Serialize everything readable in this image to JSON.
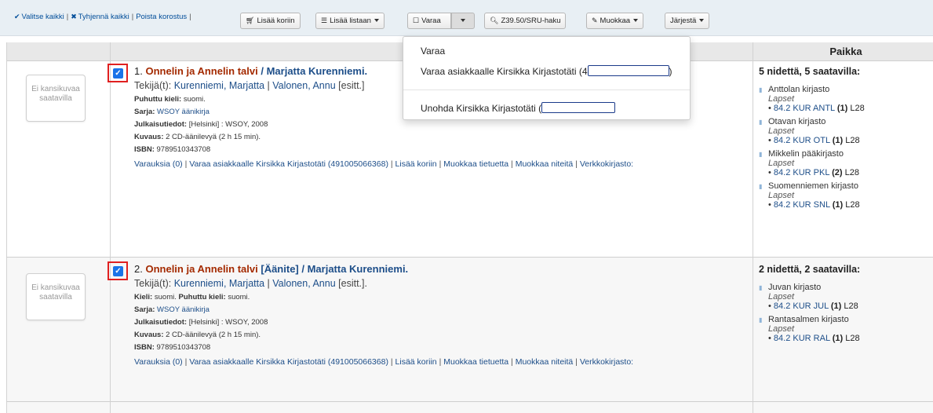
{
  "toolbar": {
    "select_all": "Valitse kaikki",
    "clear_all": "Tyhjennä kaikki",
    "remove_highlight": "Poista korostus",
    "add_to_cart": "Lisää koriin",
    "add_to_list": "Lisää listaan",
    "place_hold": "Varaa",
    "z3950": "Z39.50/SRU-haku",
    "edit": "Muokkaa",
    "sort": "Järjestä"
  },
  "hold_menu": {
    "item_hold": "Varaa",
    "item_hold_for": "Varaa asiakkaalle Kirsikka Kirjastotäti (4",
    "item_forget": "Unohda Kirsikka Kirjastotäti (",
    "item_hold_for_end": ")"
  },
  "table": {
    "header_location": "Paikka"
  },
  "cover_placeholder": "Ei kansikuvaa saatavilla",
  "records": [
    {
      "checked": true,
      "number": "1.",
      "title_a": "Onnelin ja Annelin talvi",
      "title_rest": "/ Marjatta Kurenniemi.",
      "authors_label": "Tekijä(t):",
      "author_1": "Kurenniemi, Marjatta",
      "author_2": "Valonen, Annu",
      "author_2_role": "[esitt.]",
      "language_label": "Puhuttu kieli:",
      "language_value": "suomi.",
      "series_label": "Sarja:",
      "series_value": "WSOY äänikirja",
      "pub_label": "Julkaisutiedot:",
      "pub_value": "[Helsinki] : WSOY, 2008",
      "desc_label": "Kuvaus:",
      "desc_value": "2 CD-äänilevyä (2 h 15 min).",
      "isbn_label": "ISBN:",
      "isbn_value": "9789510343708",
      "actions": [
        "Varauksia (0)",
        "Varaa asiakkaalle Kirsikka Kirjastotäti (491005066368)",
        "Lisää koriin",
        "Muokkaa tietuetta",
        "Muokkaa niteitä",
        "Verkkokirjasto:"
      ],
      "holdings_count": "5 nidettä, 5 saatavilla:",
      "holdings": [
        {
          "library": "Anttolan kirjasto",
          "collection": "Lapset",
          "call": "84.2 KUR ANTL",
          "n": "(1)",
          "loc": "L28"
        },
        {
          "library": "Otavan kirjasto",
          "collection": "Lapset",
          "call": "84.2 KUR OTL",
          "n": "(1)",
          "loc": "L28"
        },
        {
          "library": "Mikkelin pääkirjasto",
          "collection": "Lapset",
          "call": "84.2 KUR PKL",
          "n": "(2)",
          "loc": "L28"
        },
        {
          "library": "Suomenniemen kirjasto",
          "collection": "Lapset",
          "call": "84.2 KUR SNL",
          "n": "(1)",
          "loc": "L28"
        }
      ]
    },
    {
      "checked": true,
      "number": "2.",
      "title_a": "Onnelin ja Annelin talvi",
      "title_rest": "[Äänite] / Marjatta Kurenniemi.",
      "authors_label": "Tekijä(t):",
      "author_1": "Kurenniemi, Marjatta",
      "author_2": "Valonen, Annu",
      "author_2_role": "[esitt.].",
      "language_label": "Kieli:",
      "language_value": "suomi.",
      "language2_label": "Puhuttu kieli:",
      "language2_value": "suomi.",
      "series_label": "Sarja:",
      "series_value": "WSOY äänikirja",
      "pub_label": "Julkaisutiedot:",
      "pub_value": "[Helsinki] : WSOY, 2008",
      "desc_label": "Kuvaus:",
      "desc_value": "2 CD-äänilevyä (2 h 15 min).",
      "isbn_label": "ISBN:",
      "isbn_value": "9789510343708",
      "actions": [
        "Varauksia (0)",
        "Varaa asiakkaalle Kirsikka Kirjastotäti (491005066368)",
        "Lisää koriin",
        "Muokkaa tietuetta",
        "Muokkaa niteitä",
        "Verkkokirjasto:"
      ],
      "holdings_count": "2 nidettä, 2 saatavilla:",
      "holdings": [
        {
          "library": "Juvan kirjasto",
          "collection": "Lapset",
          "call": "84.2 KUR JUL",
          "n": "(1)",
          "loc": "L28"
        },
        {
          "library": "Rantasalmen kirjasto",
          "collection": "Lapset",
          "call": "84.2 KUR RAL",
          "n": "(1)",
          "loc": "L28"
        }
      ]
    }
  ]
}
